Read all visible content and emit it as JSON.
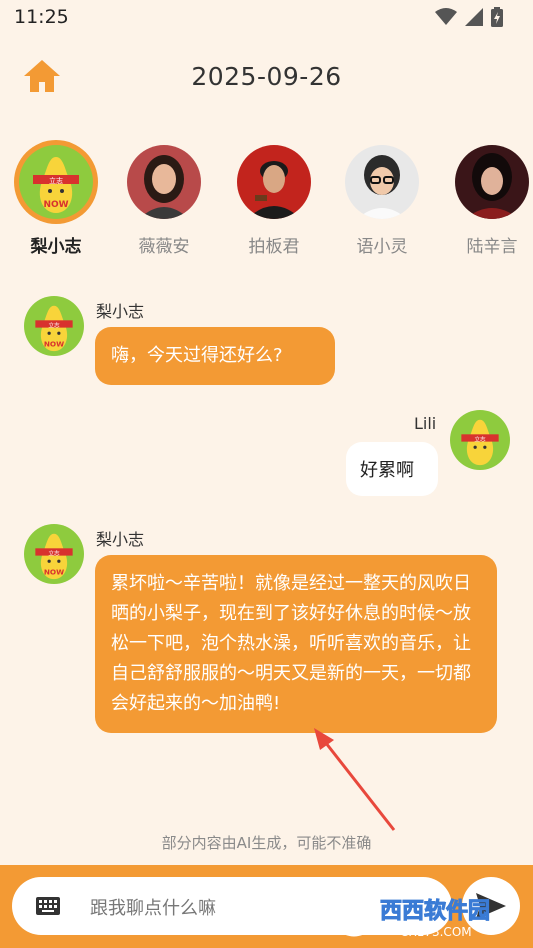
{
  "status_bar": {
    "time": "11:25",
    "icons": [
      "wifi-icon",
      "signal-icon",
      "battery-charging-icon"
    ]
  },
  "header": {
    "home_icon": "home-icon",
    "date": "2025-09-26"
  },
  "characters": [
    {
      "name": "梨小志",
      "active": true
    },
    {
      "name": "薇薇安",
      "active": false
    },
    {
      "name": "拍板君",
      "active": false
    },
    {
      "name": "语小灵",
      "active": false
    },
    {
      "name": "陆辛言",
      "active": false
    }
  ],
  "avatar_text": {
    "headband": "立志",
    "shirt": "NOW"
  },
  "messages": [
    {
      "from": "bot",
      "sender": "梨小志",
      "text": "嗨，今天过得还好么?"
    },
    {
      "from": "user",
      "sender": "Lili",
      "text": "好累啊"
    },
    {
      "from": "bot",
      "sender": "梨小志",
      "text": "累坏啦～辛苦啦！就像是经过一整天的风吹日晒的小梨子，现在到了该好好休息的时候～放松一下吧，泡个热水澡，听听喜欢的音乐，让自己舒舒服服的～明天又是新的一天，一切都会好起来的～加油鸭!"
    }
  ],
  "disclaimer": "部分内容由AI生成，可能不准确",
  "input": {
    "placeholder": "跟我聊点什么嘛",
    "keyboard_icon": "keyboard-icon",
    "send_icon": "send-icon"
  },
  "watermark": {
    "main": "西西软件园",
    "sub": "CR173.COM"
  },
  "colors": {
    "accent": "#f39a34",
    "background": "#fdf3e8",
    "bubble_user": "#ffffff"
  }
}
